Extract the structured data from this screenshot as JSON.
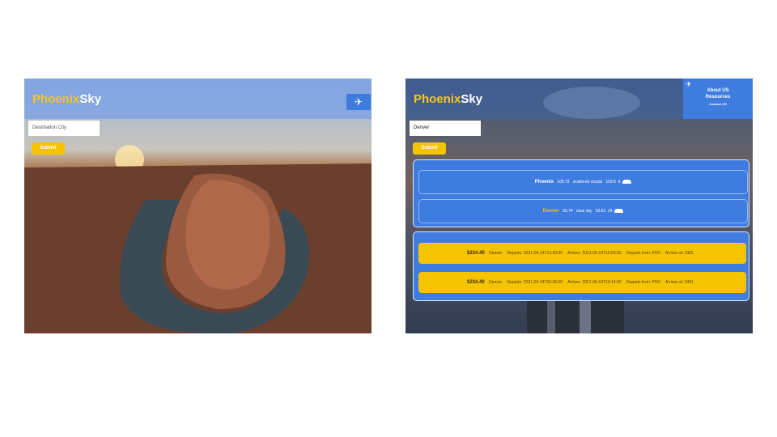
{
  "left_screen": {
    "logo_phoenix": "Phoenix",
    "logo_sky": "Sky",
    "nav_icon": "plane-icon",
    "destination_placeholder": "Destination City",
    "submit_label": "Submit"
  },
  "right_screen": {
    "logo_phoenix": "Phoenix",
    "logo_sky": "Sky",
    "nav_icon": "plane-icon",
    "menu": {
      "about": "About US",
      "resources": "Resources",
      "contact": "Contact US"
    },
    "destination_value": "Denver",
    "submit_label": "Submit",
    "weather": [
      {
        "city": "Phoenix",
        "temp": "109.72",
        "condition": "scattered clouds",
        "feels": "103.6",
        "wind": "9",
        "icon": "cloud-icon"
      },
      {
        "city": "Denver",
        "temp": "93.74",
        "condition": "clear sky",
        "feels": "92.61",
        "wind": "24",
        "icon": "cloud-icon"
      }
    ],
    "flights": [
      {
        "price": "$234.40",
        "airline": "Denver",
        "departs": "Departs: 2021-06-14T13:20:00",
        "arrives": "Arrives: 2021-06-14T16:03:00",
        "from": "Departs from: PHX",
        "to": "Arrives at: DEN"
      },
      {
        "price": "$234.40",
        "airline": "Denver",
        "departs": "Departs: 2021-06-14T16:36:00",
        "arrives": "Arrives: 2021-06-14T19:14:00",
        "from": "Departs from: PHX",
        "to": "Arrives at: DEN"
      }
    ],
    "colors": {
      "primary": "#3f7ce0",
      "accent": "#f5c400"
    }
  }
}
